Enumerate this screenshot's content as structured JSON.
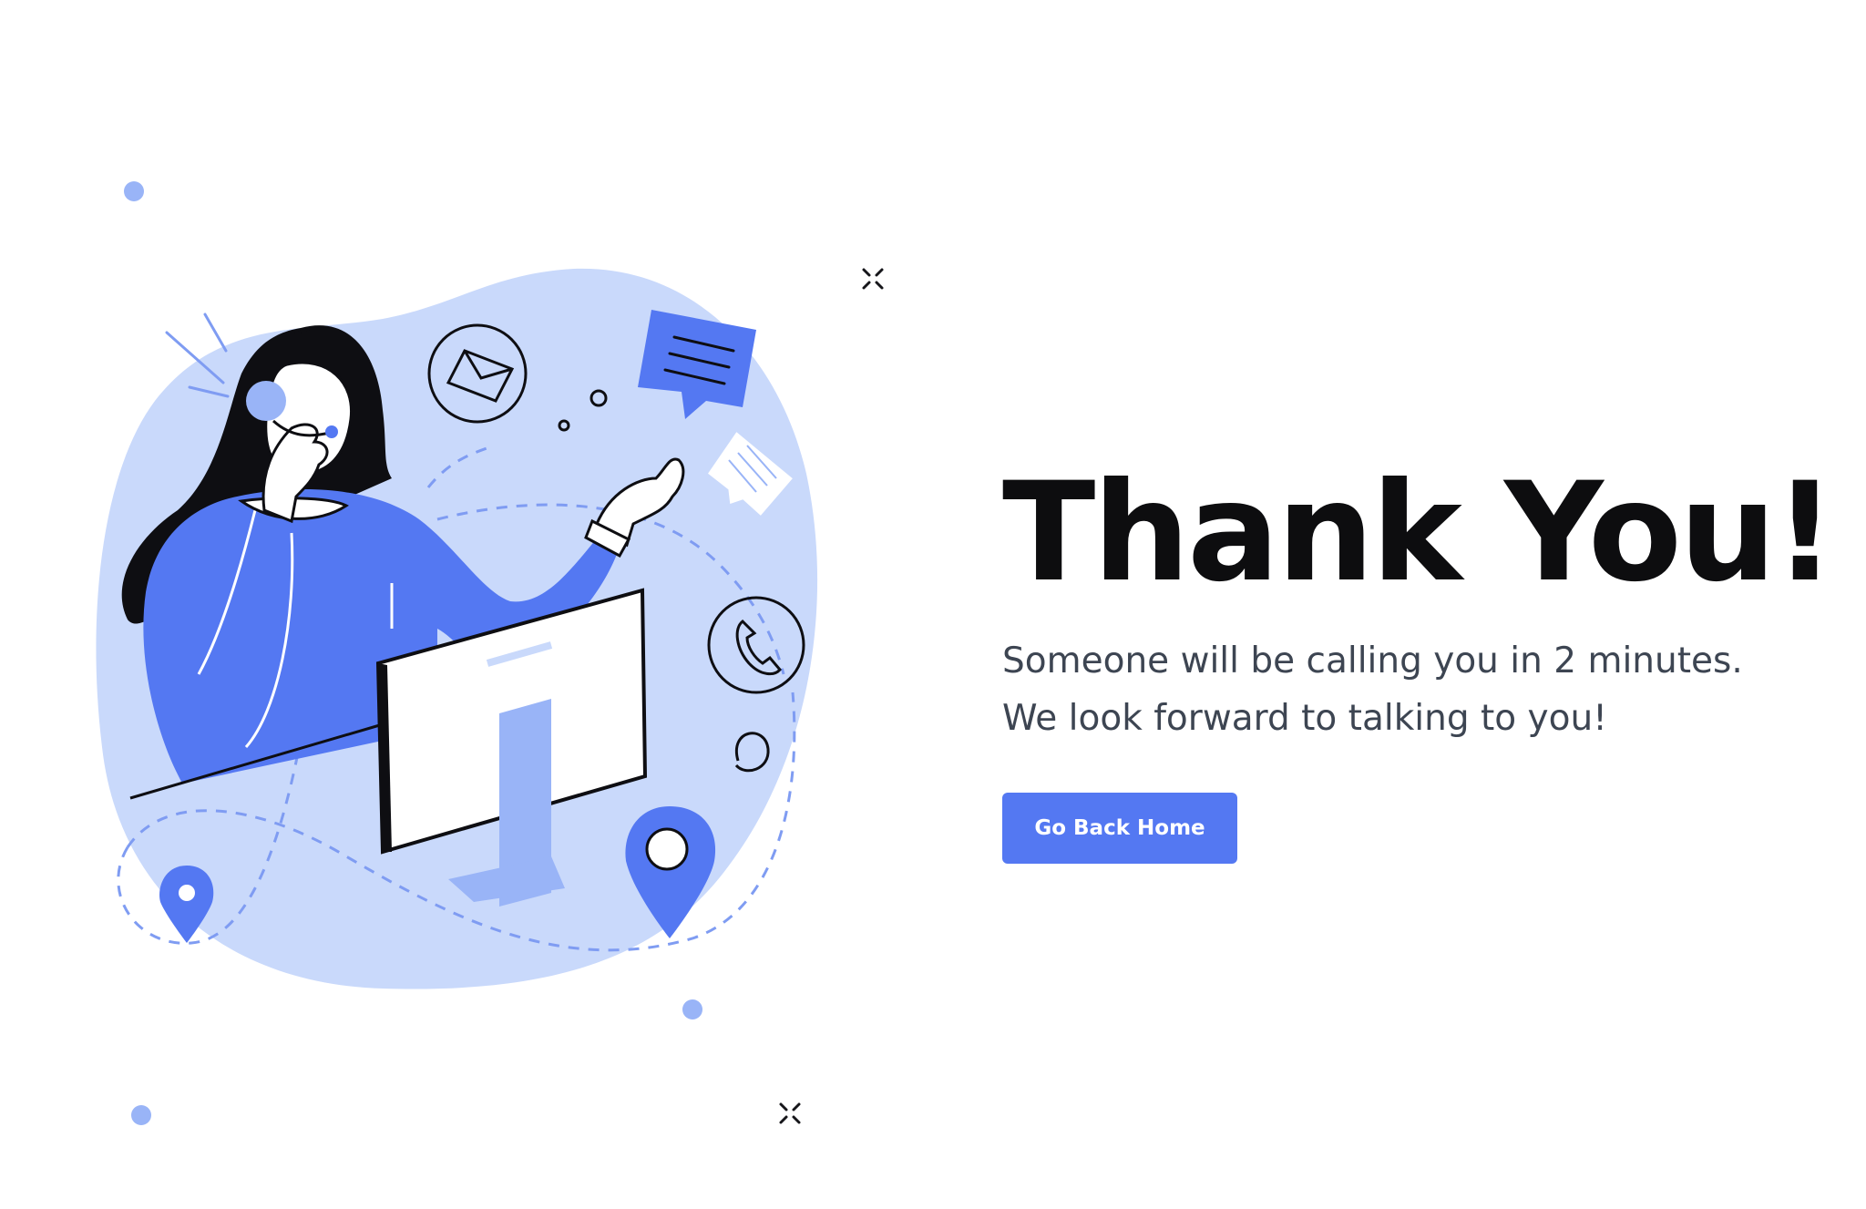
{
  "page": {
    "title": "Thank You!",
    "message_line1": "Someone will be calling you in 2 minutes.",
    "message_line2": "We look forward to talking to you!",
    "button_label": "Go Back Home"
  },
  "colors": {
    "accent": "#5478f2",
    "accent_light": "#c9d9fb",
    "accent_mid": "#99b4f7",
    "text_dark": "#0d0d0f",
    "text_body": "#3d4552"
  },
  "illustration": {
    "subject": "customer-support-agent",
    "icons": [
      "headset-icon",
      "envelope-icon",
      "chat-bubble-icon",
      "phone-icon",
      "location-pin-icon",
      "monitor-icon"
    ]
  }
}
